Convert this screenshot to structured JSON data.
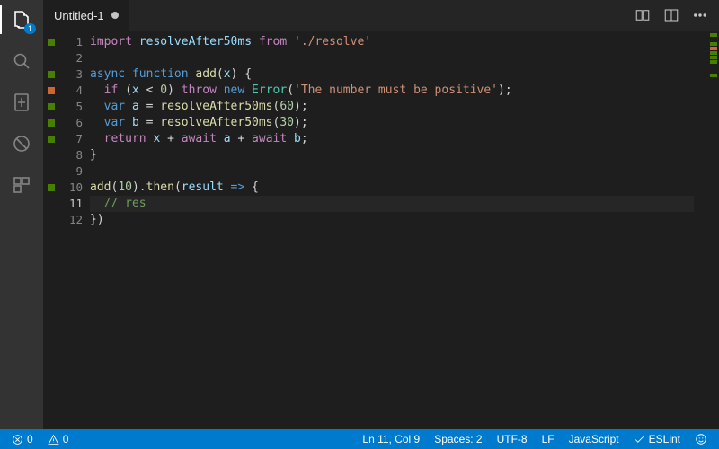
{
  "activityBar": {
    "explorerBadge": "1"
  },
  "tabs": {
    "active": {
      "title": "Untitled-1",
      "dirty": true
    }
  },
  "gutter": {
    "lines": [
      {
        "n": 1,
        "marker": "green"
      },
      {
        "n": 2,
        "marker": null
      },
      {
        "n": 3,
        "marker": "green"
      },
      {
        "n": 4,
        "marker": "orange"
      },
      {
        "n": 5,
        "marker": "green"
      },
      {
        "n": 6,
        "marker": "green"
      },
      {
        "n": 7,
        "marker": "green"
      },
      {
        "n": 8,
        "marker": null
      },
      {
        "n": 9,
        "marker": null
      },
      {
        "n": 10,
        "marker": "green"
      },
      {
        "n": 11,
        "marker": null
      },
      {
        "n": 12,
        "marker": null
      }
    ],
    "currentLine": 11
  },
  "code": {
    "lines": [
      [
        {
          "t": "import ",
          "c": "kw-import"
        },
        {
          "t": "resolveAfter50ms",
          "c": "ident"
        },
        {
          "t": " from ",
          "c": "kw-import"
        },
        {
          "t": "'./resolve'",
          "c": "str"
        }
      ],
      [],
      [
        {
          "t": "async ",
          "c": "kw-async"
        },
        {
          "t": "function ",
          "c": "kw-decl"
        },
        {
          "t": "add",
          "c": "fn"
        },
        {
          "t": "(",
          "c": "punc"
        },
        {
          "t": "x",
          "c": "ident"
        },
        {
          "t": ") {",
          "c": "punc"
        }
      ],
      [
        {
          "t": "  ",
          "c": "punc"
        },
        {
          "t": "if ",
          "c": "kw-ctrl"
        },
        {
          "t": "(",
          "c": "punc"
        },
        {
          "t": "x",
          "c": "ident"
        },
        {
          "t": " < ",
          "c": "punc"
        },
        {
          "t": "0",
          "c": "num"
        },
        {
          "t": ") ",
          "c": "punc"
        },
        {
          "t": "throw ",
          "c": "kw-ctrl"
        },
        {
          "t": "new ",
          "c": "kw-decl"
        },
        {
          "t": "Error",
          "c": "cls"
        },
        {
          "t": "(",
          "c": "punc"
        },
        {
          "t": "'The number must be positive'",
          "c": "str"
        },
        {
          "t": ");",
          "c": "punc"
        }
      ],
      [
        {
          "t": "  ",
          "c": "punc"
        },
        {
          "t": "var ",
          "c": "kw-decl"
        },
        {
          "t": "a",
          "c": "ident"
        },
        {
          "t": " = ",
          "c": "punc"
        },
        {
          "t": "resolveAfter50ms",
          "c": "fn"
        },
        {
          "t": "(",
          "c": "punc"
        },
        {
          "t": "60",
          "c": "num"
        },
        {
          "t": ");",
          "c": "punc"
        }
      ],
      [
        {
          "t": "  ",
          "c": "punc"
        },
        {
          "t": "var ",
          "c": "kw-decl"
        },
        {
          "t": "b",
          "c": "ident"
        },
        {
          "t": " = ",
          "c": "punc"
        },
        {
          "t": "resolveAfter50ms",
          "c": "fn"
        },
        {
          "t": "(",
          "c": "punc"
        },
        {
          "t": "30",
          "c": "num"
        },
        {
          "t": ");",
          "c": "punc"
        }
      ],
      [
        {
          "t": "  ",
          "c": "punc"
        },
        {
          "t": "return ",
          "c": "kw-ctrl"
        },
        {
          "t": "x",
          "c": "ident"
        },
        {
          "t": " + ",
          "c": "punc"
        },
        {
          "t": "await ",
          "c": "kw-await"
        },
        {
          "t": "a",
          "c": "ident"
        },
        {
          "t": " + ",
          "c": "punc"
        },
        {
          "t": "await ",
          "c": "kw-await"
        },
        {
          "t": "b",
          "c": "ident"
        },
        {
          "t": ";",
          "c": "punc"
        }
      ],
      [
        {
          "t": "}",
          "c": "punc"
        }
      ],
      [],
      [
        {
          "t": "add",
          "c": "fn"
        },
        {
          "t": "(",
          "c": "punc"
        },
        {
          "t": "10",
          "c": "num"
        },
        {
          "t": ").",
          "c": "punc"
        },
        {
          "t": "then",
          "c": "fn"
        },
        {
          "t": "(",
          "c": "punc"
        },
        {
          "t": "result",
          "c": "ident"
        },
        {
          "t": " => ",
          "c": "kw-decl"
        },
        {
          "t": "{",
          "c": "punc"
        }
      ],
      [
        {
          "t": "  ",
          "c": "punc"
        },
        {
          "t": "// res",
          "c": "cmt"
        }
      ],
      [
        {
          "t": "})",
          "c": "punc"
        }
      ]
    ]
  },
  "statusbar": {
    "errors": "0",
    "warnings": "0",
    "lineCol": "Ln 11, Col 9",
    "spaces": "Spaces: 2",
    "encoding": "UTF-8",
    "eol": "LF",
    "language": "JavaScript",
    "eslint": "ESLint"
  }
}
